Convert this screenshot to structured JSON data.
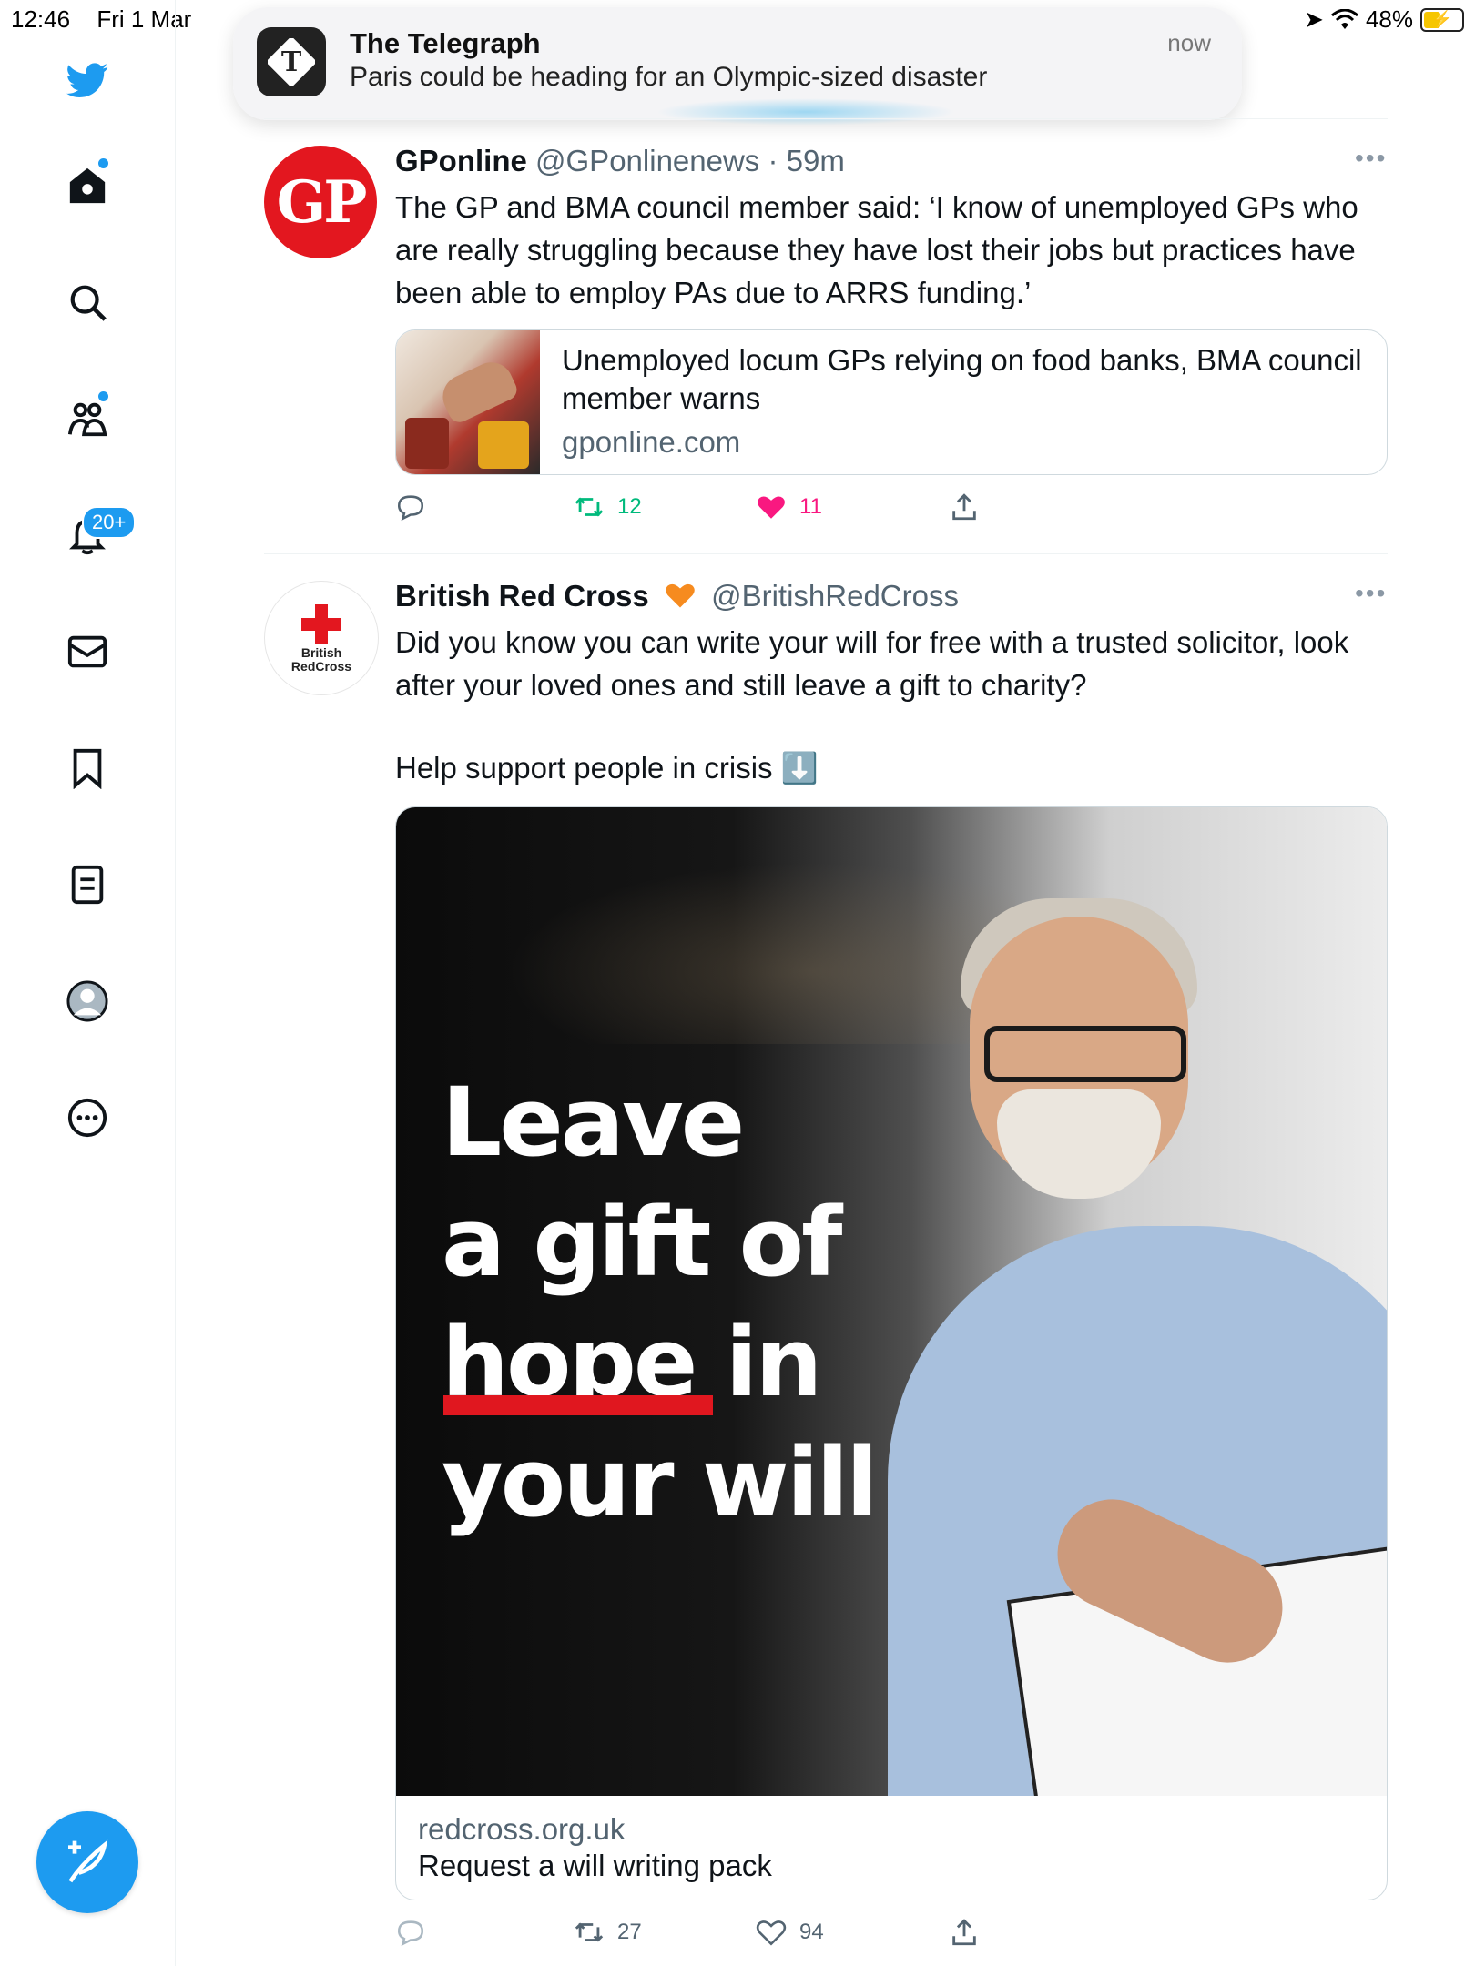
{
  "status_bar": {
    "time": "12:46",
    "date": "Fri 1 Mar",
    "battery": "48%"
  },
  "notification": {
    "app": "The Telegraph",
    "message": "Paris could be heading for an Olympic-sized disaster",
    "time": "now"
  },
  "sidebar": {
    "notifications_badge": "20+",
    "items": [
      "home",
      "explore",
      "communities",
      "notifications",
      "messages",
      "bookmarks",
      "lists",
      "profile",
      "more"
    ]
  },
  "tweets": [
    {
      "name": "GPonline",
      "handle": "@GPonlinenews",
      "time": "59m",
      "avatar_text": "GP",
      "text": "The GP and BMA council member said: ‘I know of unemployed GPs who are really struggling because they have lost their jobs but practices have been able to employ PAs due to ARRS funding.’",
      "link_card": {
        "title": "Unemployed locum GPs relying on food banks, BMA council member warns",
        "domain": "gponline.com"
      },
      "retweets": "12",
      "likes": "11"
    },
    {
      "name": "British Red Cross",
      "handle": "@BritishRedCross",
      "avatar_line1": "British",
      "avatar_line2": "RedCross",
      "text_line1": "Did you know you can write your will for free with a trusted solicitor, look after your loved ones and still leave a gift to charity?",
      "text_line2": "Help support people in crisis ⬇️",
      "media": {
        "headline_line1": "Leave",
        "headline_line2": "a gift of",
        "headline_line3": "hope in",
        "headline_line4": "your will",
        "domain": "redcross.org.uk",
        "cta": "Request a will writing pack"
      },
      "retweets": "27",
      "likes": "94"
    }
  ],
  "colors": {
    "accent": "#1d9bf0",
    "retweet_active": "#00ba7c",
    "like_active": "#f91880",
    "gp_red": "#e3171f"
  }
}
